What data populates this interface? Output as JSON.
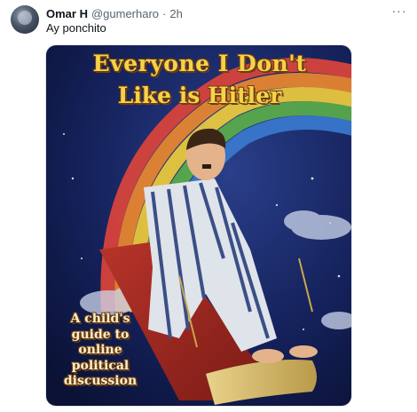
{
  "tweet": {
    "author_name": "Omar H",
    "author_handle": "@gumerharo",
    "separator": "·",
    "time": "2h",
    "more_label": "···",
    "text": "Ay ponchito"
  },
  "media": {
    "caption_line1": "Everyone I Don't",
    "caption_line2": "Like is Hitler",
    "caption_bottom": "A child's guide to online political discussion"
  },
  "colors": {
    "text_primary": "#0f1419",
    "text_secondary": "#536471",
    "caption_gold": "#f6d24a"
  }
}
